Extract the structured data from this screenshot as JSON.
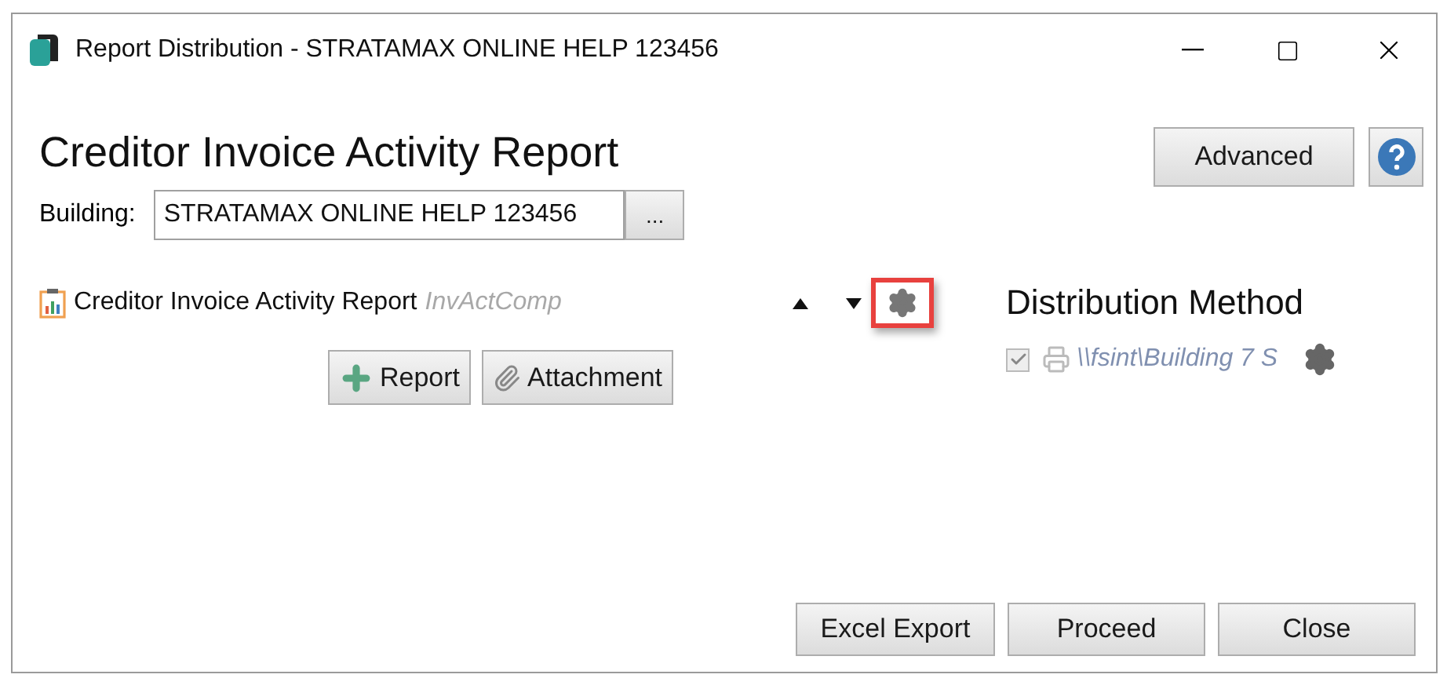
{
  "window": {
    "title": "Report Distribution - STRATAMAX ONLINE HELP 123456"
  },
  "heading": "Creditor Invoice Activity Report",
  "advanced_button": "Advanced",
  "building": {
    "label": "Building:",
    "value": "STRATAMAX ONLINE HELP 123456",
    "browse": "..."
  },
  "report": {
    "name": "Creditor Invoice Activity Report",
    "code": "InvActComp",
    "settings_highlighted": true
  },
  "report_buttons": [
    "Report",
    "Attachment"
  ],
  "distribution": {
    "title": "Distribution Method",
    "methods": [
      {
        "checked": true,
        "disabled": true,
        "path": "\\\\fsint\\Building 7 S"
      }
    ]
  },
  "footer_buttons": [
    "Excel Export",
    "Proceed",
    "Close"
  ]
}
